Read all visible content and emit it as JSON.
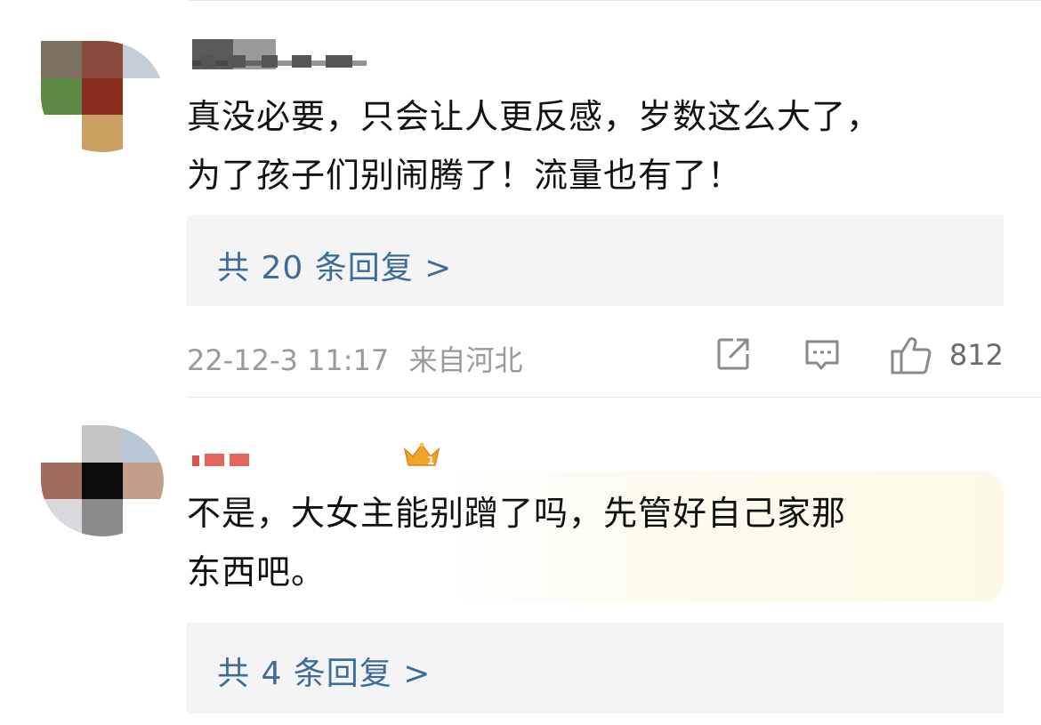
{
  "comments": [
    {
      "username": "",
      "text_line1": "真没必要，只会让人更反感，岁数这么大了，",
      "text_line2": "为了孩子们别闹腾了！流量也有了！",
      "reply_link": "共 20 条回复 >",
      "date": "22-12-3 11:17",
      "location": "来自河北",
      "like_count": "812",
      "icons": [
        "share-icon",
        "comment-icon",
        "like-icon"
      ],
      "avatar_colors": [
        "#7b7062",
        "#8a4b3c",
        "#c4ccd4",
        "#5d8a44",
        "#8b2e22",
        "#ffffff",
        "#ffffff",
        "#a25e2a",
        "#ffffff"
      ]
    },
    {
      "username": "",
      "badge": "crown-badge-icon",
      "text_line1": "不是，大女主能别蹭了吗，先管好自己家那",
      "text_line2": "东西吧。",
      "reply_link": "共 4 条回复 >",
      "avatar_colors": [
        "#ffffff",
        "#c5c5c5",
        "#ffffff",
        "#a06c5c",
        "#0b0b0b",
        "#c29f8a",
        "#d8d8dd",
        "#8a8a8a",
        "#ffffff"
      ]
    }
  ],
  "colors": {
    "link": "#3e6c9a",
    "meta": "#9a9a9a",
    "reply_bg": "#f4f4f4",
    "highlight_bg": "#fbf9e6"
  }
}
